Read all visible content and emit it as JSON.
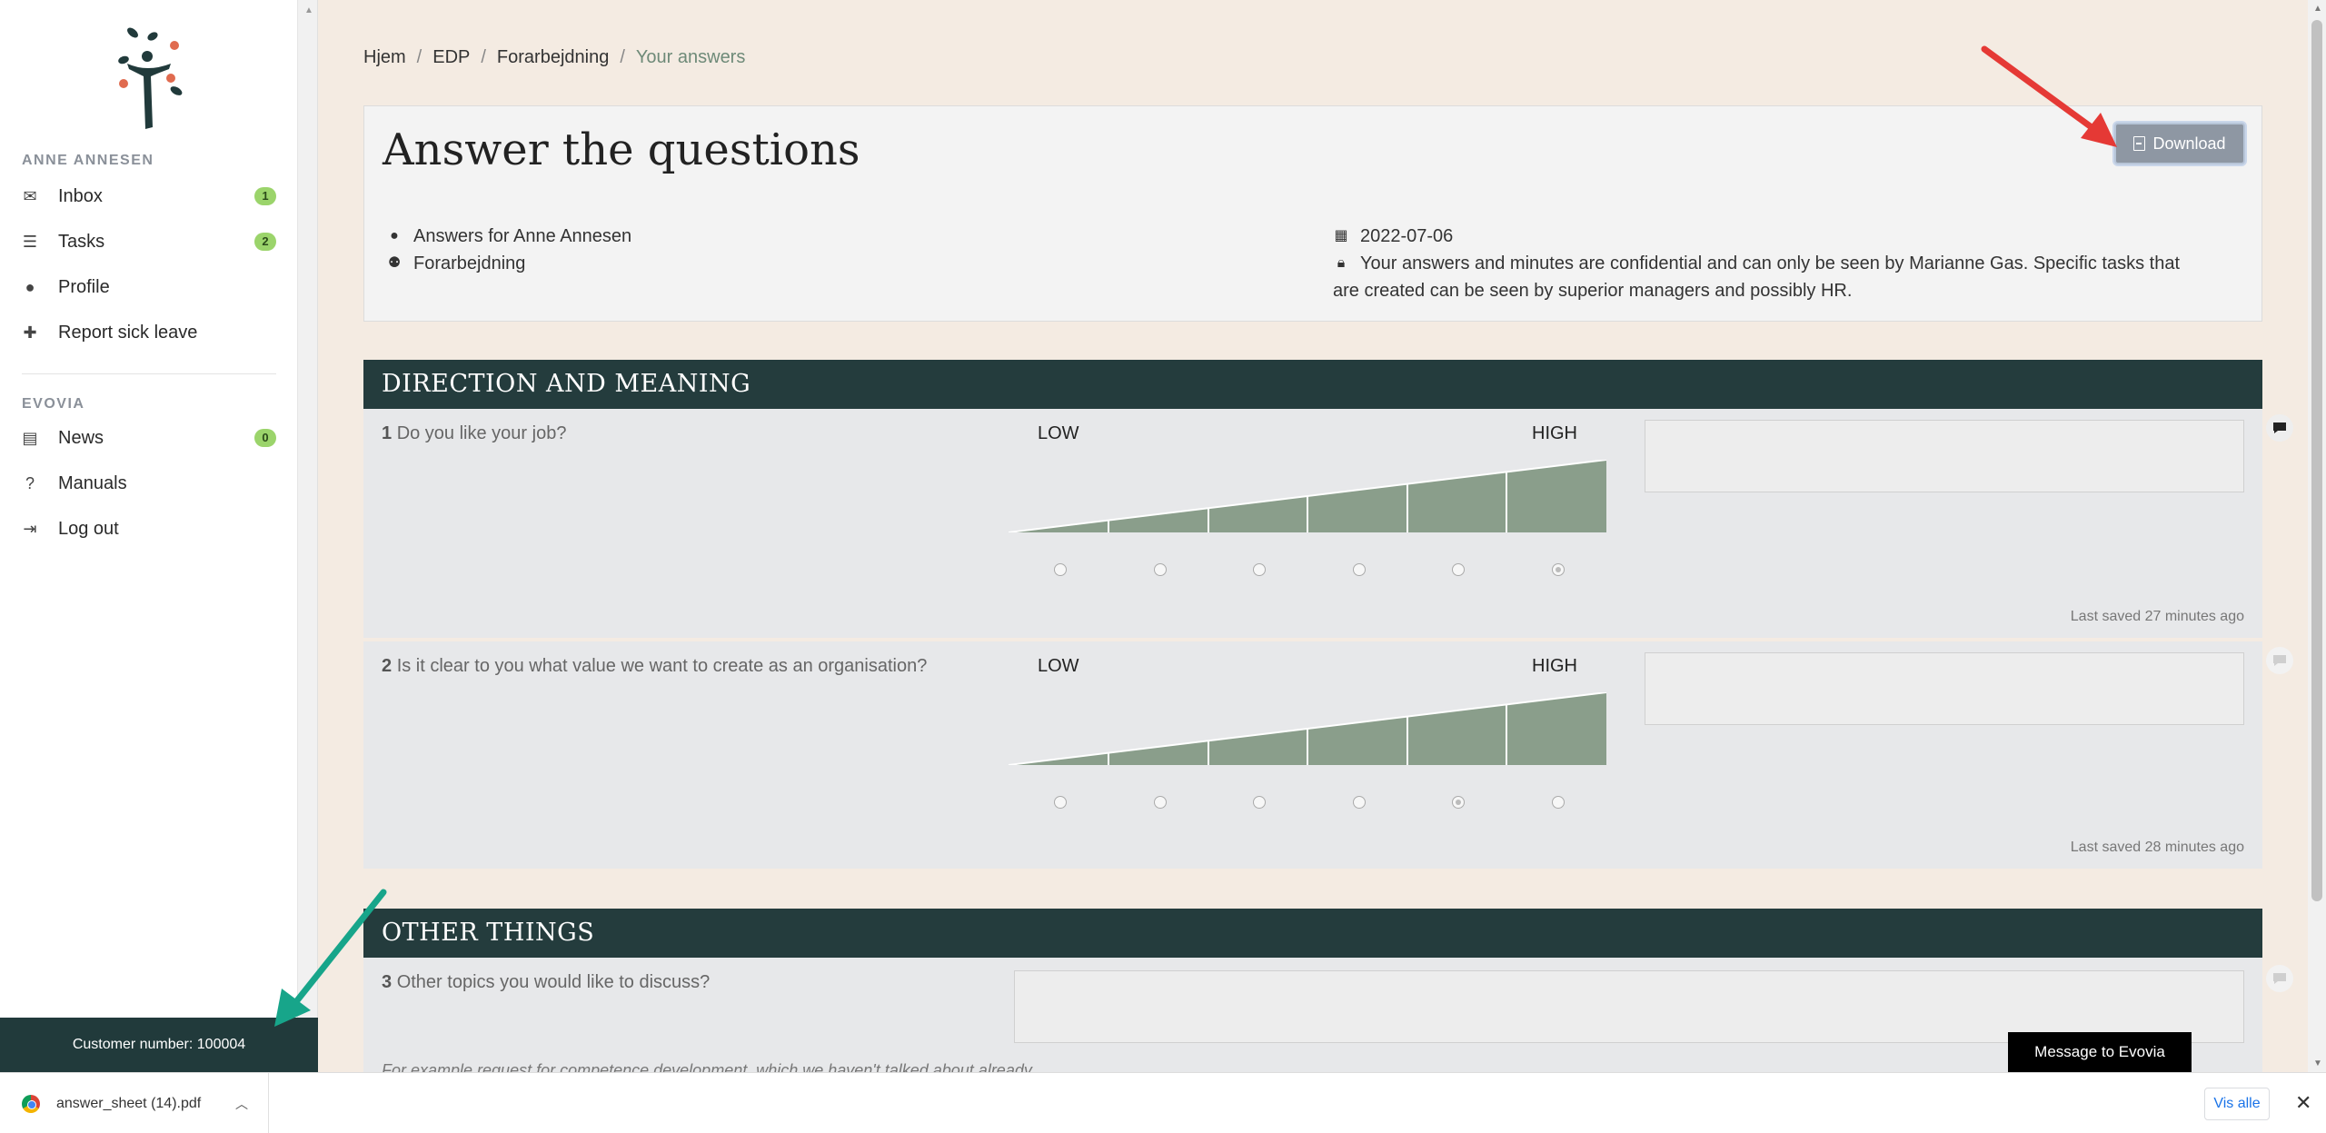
{
  "sidebar": {
    "user_section": "ANNE ANNESEN",
    "items": [
      {
        "label": "Inbox",
        "badge": "1",
        "icon": "envelope-icon"
      },
      {
        "label": "Tasks",
        "badge": "2",
        "icon": "tasks-icon"
      },
      {
        "label": "Profile",
        "icon": "user-icon"
      },
      {
        "label": "Report sick leave",
        "icon": "plus-icon"
      }
    ],
    "org_section": "EVOVIA",
    "org_items": [
      {
        "label": "News",
        "badge": "0",
        "icon": "newspaper-icon"
      },
      {
        "label": "Manuals",
        "icon": "question-icon"
      },
      {
        "label": "Log out",
        "icon": "logout-icon"
      }
    ],
    "customer_number": "Customer number: 100004"
  },
  "breadcrumb": [
    "Hjem",
    "EDP",
    "Forarbejdning",
    "Your answers"
  ],
  "header": {
    "title": "Answer the questions",
    "download_label": "Download",
    "answers_for": "Answers for Anne Annesen",
    "group": "Forarbejdning",
    "date": "2022-07-06",
    "confidential_line1": "Your answers and minutes are confidential and can only be seen by Marianne Gas. Specific tasks that",
    "confidential_line2": "are created can be seen by superior managers and possibly HR."
  },
  "sections": [
    {
      "title": "DIRECTION AND MEANING",
      "questions": [
        {
          "number": "1",
          "text": "Do you like your job?",
          "low": "LOW",
          "high": "HIGH",
          "selected": 6,
          "saved": "Last saved 27 minutes ago"
        },
        {
          "number": "2",
          "text": "Is it clear to you what value we want to create as an organisation?",
          "low": "LOW",
          "high": "HIGH",
          "selected": 5,
          "saved": "Last saved 28 minutes ago"
        }
      ]
    },
    {
      "title": "OTHER THINGS",
      "questions": [
        {
          "number": "3",
          "text": "Other topics you would like to discuss?",
          "hint": "For example request for competence development, which we haven't talked about already"
        }
      ]
    }
  ],
  "message_button": "Message to Evovia",
  "download_bar": {
    "file": "answer_sheet (14).pdf",
    "show_all": "Vis alle"
  },
  "colors": {
    "section_bar": "#243c3d",
    "scale_fill": "#8a9e8b",
    "badge": "#9bd46b",
    "background": "#f4ebe2"
  }
}
